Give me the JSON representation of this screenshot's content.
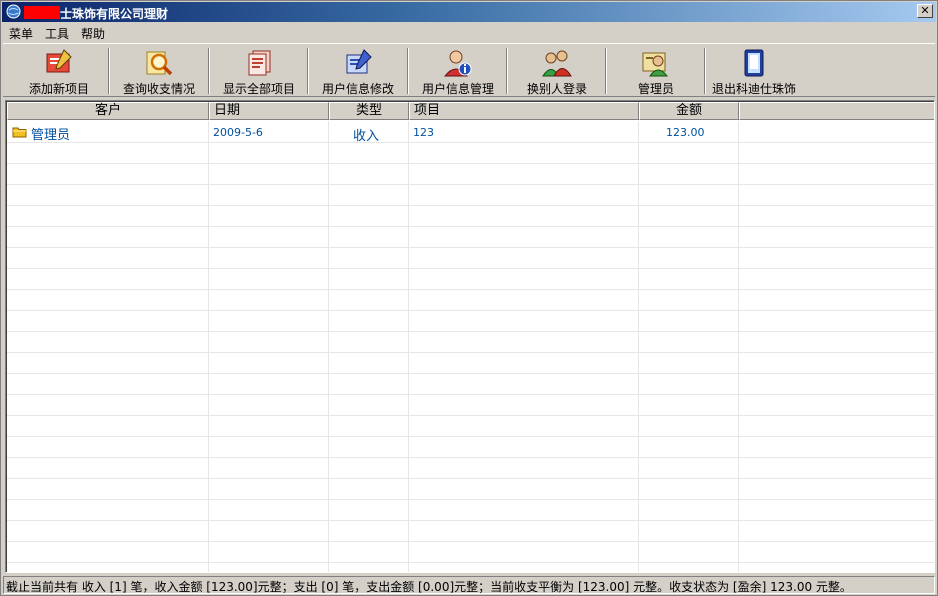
{
  "window": {
    "title": "士珠饰有限公司理财",
    "close_glyph": "✕"
  },
  "menu": [
    "菜单",
    "工具",
    "帮助"
  ],
  "toolbar": [
    {
      "label": "添加新项目",
      "icon": "add-item-icon"
    },
    {
      "label": "查询收支情况",
      "icon": "search-icon"
    },
    {
      "label": "显示全部项目",
      "icon": "documents-icon"
    },
    {
      "label": "用户信息修改",
      "icon": "edit-user-icon"
    },
    {
      "label": "用户信息管理",
      "icon": "user-info-icon"
    },
    {
      "label": "换别人登录",
      "icon": "switch-user-icon"
    },
    {
      "label": "管理员",
      "icon": "admin-icon"
    },
    {
      "label": "退出科迪仕珠饰",
      "icon": "exit-icon"
    }
  ],
  "table": {
    "columns": [
      "客户",
      "日期",
      "类型",
      "项目",
      "金额",
      ""
    ],
    "rows": [
      {
        "customer": "管理员",
        "date": "2009-5-6",
        "type": "收入",
        "item": "123",
        "amount": "123.00"
      }
    ]
  },
  "status": {
    "text": "截止当前共有 收入 [1] 笔，收入金额 [123.00]元整；支出 [0] 笔，支出金额 [0.00]元整；当前收支平衡为 [123.00] 元整。收支状态为 [盈余] 123.00 元整。"
  }
}
